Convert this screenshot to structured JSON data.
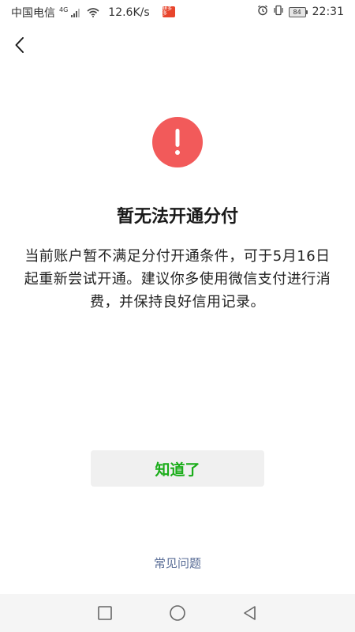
{
  "status_bar": {
    "carrier": "中国电信",
    "network": "4G",
    "speed": "12.6K/s",
    "app_badge": "拼多多",
    "battery": "84",
    "time": "22:31"
  },
  "dialog": {
    "title": "暂无法开通分付",
    "message": "当前账户暂不满足分付开通条件，可于5月16日起重新尝试开通。建议你多使用微信支付进行消费，并保持良好信用记录。",
    "ok_label": "知道了",
    "faq_label": "常见问题"
  },
  "colors": {
    "warning": "#f25a5a",
    "accent_green": "#1aad19",
    "link_blue": "#576b95"
  },
  "icons": {
    "back": "back-arrow-icon",
    "warning": "exclamation-circle-icon",
    "nav_recent": "square-icon",
    "nav_home": "circle-icon",
    "nav_back": "triangle-back-icon"
  }
}
